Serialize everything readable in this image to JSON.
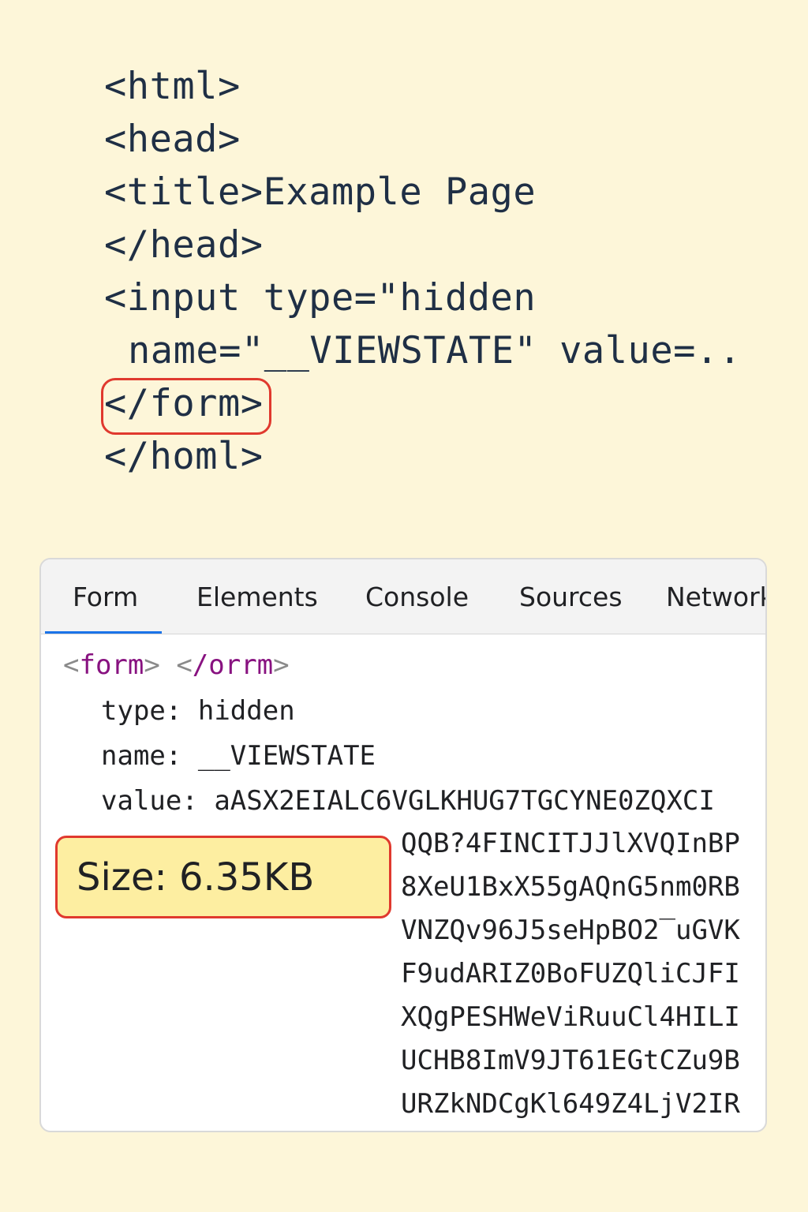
{
  "source_code": {
    "lines": [
      "<html>",
      "<head>",
      "<title>Example Page",
      "</head>",
      "<input type=\"hidden",
      "name=\"__VIEWSTATE\" value=..",
      "</form>",
      "</homl>"
    ],
    "highlighted_line_index": 6
  },
  "devtools": {
    "tabs": [
      {
        "label": "Form",
        "active": true
      },
      {
        "label": "Elements",
        "active": false
      },
      {
        "label": "Console",
        "active": false
      },
      {
        "label": "Sources",
        "active": false
      },
      {
        "label": "Network",
        "active": false
      }
    ],
    "element_header": {
      "open_tag": "form",
      "close_tag": "/orrm"
    },
    "properties": [
      {
        "key": "type:",
        "value": "hidden"
      },
      {
        "key": "name:",
        "value": "__VIEWSTATE"
      },
      {
        "key": "value:",
        "value": "aASX2EIALC6VGLKHUG7TGCYNE0ZQXCI"
      }
    ],
    "value_continuation": [
      "QQB?4FINCITJJlXVQInBP",
      "8XeU1BxX55gAQnG5nm0RB",
      "VNZQv96J5seHpBO2‾uGVK",
      "F9udARIZ0BoFUZQliCJFI",
      "XQgPESHWeViRuuСl4HILI",
      "UCHB8ImV9JT61EGtCZu9B",
      "URZkNDCgKl649Z4LjV2IR"
    ],
    "size_badge": "Size: 6.35KB"
  },
  "colors": {
    "background": "#fdf6d9",
    "code_text": "#1f2f45",
    "highlight_border": "#e0392e",
    "active_tab_underline": "#1a73e8",
    "tag_name": "#881280",
    "badge_fill": "#fdeea1"
  }
}
